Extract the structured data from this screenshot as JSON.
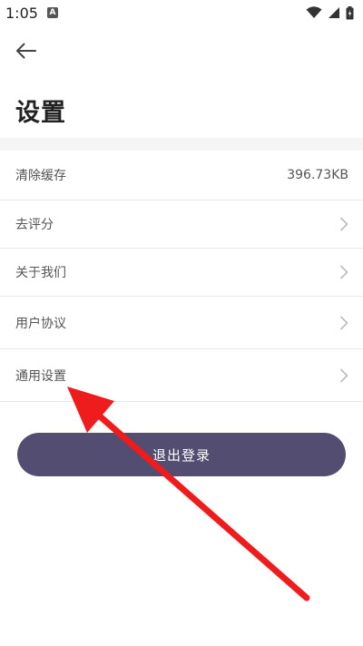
{
  "status_bar": {
    "time": "1:05"
  },
  "header": {
    "title": "设置"
  },
  "settings": {
    "items": [
      {
        "label": "清除缓存",
        "value": "396.73KB"
      },
      {
        "label": "去评分"
      },
      {
        "label": "关于我们"
      },
      {
        "label": "用户协议"
      },
      {
        "label": "通用设置"
      }
    ]
  },
  "logout": {
    "label": "退出登录"
  },
  "colors": {
    "logout_button": "#544d72",
    "annotation_arrow": "#ee1c1c",
    "divider": "#e8e8e8"
  },
  "icons": [
    "notification-icon",
    "wifi-icon",
    "signal-icon",
    "battery-icon",
    "back-arrow-icon",
    "chevron-right-icon"
  ]
}
